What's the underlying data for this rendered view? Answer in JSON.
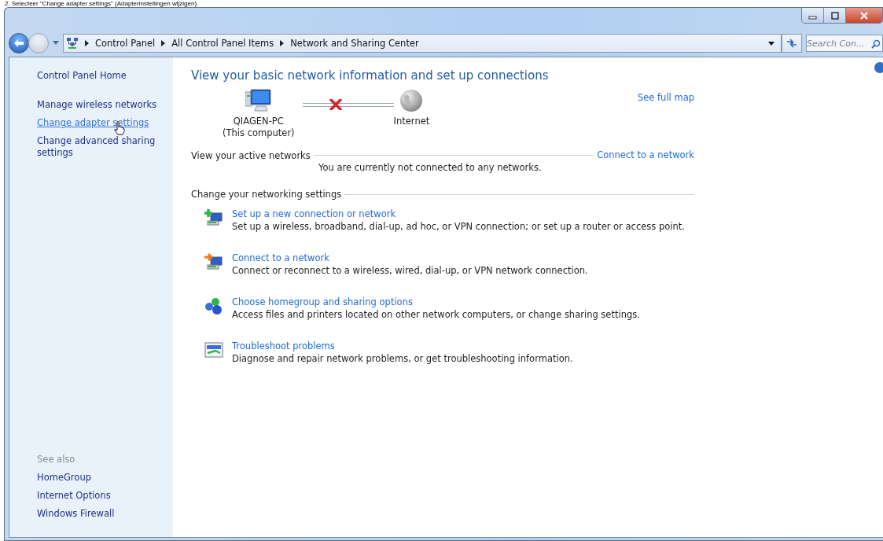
{
  "caption": "2. Selecteer \"Change adapter settings\" (Adapterinstellingen wijzigen).",
  "address_bar": {
    "breadcrumbs": [
      "Control Panel",
      "All Control Panel Items",
      "Network and Sharing Center"
    ]
  },
  "search": {
    "placeholder": "Search Con..."
  },
  "sidebar": {
    "home": "Control Panel Home",
    "items": [
      {
        "label": "Manage wireless networks",
        "hovered": false
      },
      {
        "label": "Change adapter settings",
        "hovered": true
      },
      {
        "label": "Change advanced sharing settings",
        "hovered": false
      }
    ],
    "see_also": {
      "heading": "See also",
      "items": [
        "HomeGroup",
        "Internet Options",
        "Windows Firewall"
      ]
    }
  },
  "main": {
    "title": "View your basic network information and set up connections",
    "see_full_map": "See full map",
    "map": {
      "computer": "QIAGEN-PC",
      "computer_note": "(This computer)",
      "internet": "Internet",
      "connected": false
    },
    "active_networks": {
      "heading": "View your active networks",
      "link": "Connect to a network",
      "message": "You are currently not connected to any networks."
    },
    "settings": {
      "heading": "Change your networking settings",
      "tasks": [
        {
          "kind": "new-connection",
          "title": "Set up a new connection or network",
          "description": "Set up a wireless, broadband, dial-up, ad hoc, or VPN connection; or set up a router or access point."
        },
        {
          "kind": "connect",
          "title": "Connect to a network",
          "description": "Connect or reconnect to a wireless, wired, dial-up, or VPN network connection."
        },
        {
          "kind": "homegroup",
          "title": "Choose homegroup and sharing options",
          "description": "Access files and printers located on other network computers, or change sharing settings."
        },
        {
          "kind": "troubleshoot",
          "title": "Troubleshoot problems",
          "description": "Diagnose and repair network problems, or get troubleshooting information."
        }
      ]
    }
  }
}
